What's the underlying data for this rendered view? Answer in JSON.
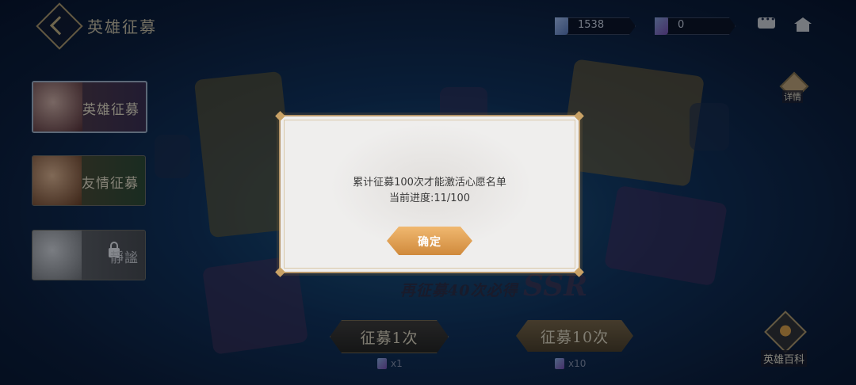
{
  "header": {
    "title": "英雄征募",
    "diamond_count": "1538",
    "ticket_count": "0"
  },
  "sidebar": {
    "items": [
      {
        "label": "英雄征募",
        "selected": true
      },
      {
        "label": "友情征募",
        "selected": false
      },
      {
        "label": "靜謐",
        "locked": true
      }
    ]
  },
  "right_panel": {
    "detail_label": "详情",
    "codex_label": "英雄百科"
  },
  "banner": {
    "guarantee_text": "再征募40次必得",
    "ssr_text": "SSR"
  },
  "actions": {
    "recruit_1_label": "征募1次",
    "recruit_10_label": "征募10次",
    "cost_1": "x1",
    "cost_10": "x10"
  },
  "modal": {
    "message_line1": "累计征募100次才能激活心愿名单",
    "message_line2": "当前进度:11/100",
    "confirm_label": "确定"
  }
}
